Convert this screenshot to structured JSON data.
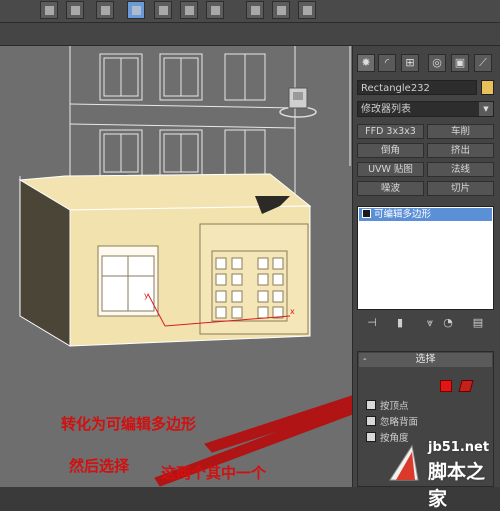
{
  "panel": {
    "object_name": "Rectangle232",
    "object_color": "#e8c15c",
    "modifier_list": "修改器列表",
    "modifier_buttons": [
      {
        "label": "FFD 3x3x3"
      },
      {
        "label": "车削"
      },
      {
        "label": "倒角"
      },
      {
        "label": "挤出"
      },
      {
        "label": "UVW 贴图"
      },
      {
        "label": "法线"
      },
      {
        "label": "噪波"
      },
      {
        "label": "切片"
      }
    ],
    "stack_item": "可编辑多边形",
    "selection_title": "选择",
    "selection_minus": "-",
    "options": [
      "按顶点",
      "忽略背面",
      "按角度"
    ]
  },
  "annotations": {
    "line1": "转化为可编辑多边形",
    "line2": "然后选择",
    "line3": "这两个其中一个"
  },
  "watermark": {
    "site": "jb51.net",
    "name": "脚本之家"
  }
}
